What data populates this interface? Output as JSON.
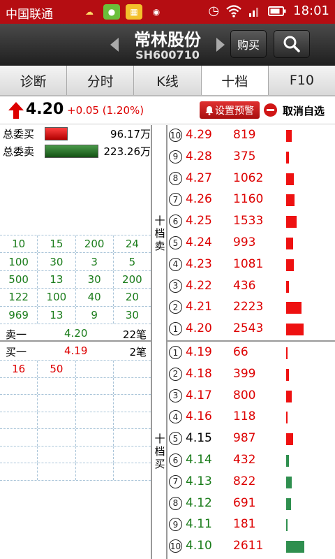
{
  "statusbar": {
    "carrier": "中国联通",
    "time": "18:01"
  },
  "header": {
    "stock_name": "常林股份",
    "stock_code": "SH600710",
    "buy_label": "购买"
  },
  "tabs": [
    {
      "label": "诊断",
      "active": false
    },
    {
      "label": "分时",
      "active": false
    },
    {
      "label": "K线",
      "active": false
    },
    {
      "label": "十档",
      "active": true
    },
    {
      "label": "F10",
      "active": false
    }
  ],
  "quote": {
    "price": "4.20",
    "change": "+0.05 (1.20%)",
    "alert_label": "设置预警",
    "remove_label": "取消自选"
  },
  "colors": {
    "up": "#dd0000",
    "down": "#1a7c1a",
    "neutral": "#000000",
    "statusbar": "#b50d12"
  },
  "weibi": {
    "buy_label": "总委买",
    "buy_value": "96.17万",
    "sell_label": "总委卖",
    "sell_value": "223.26万",
    "buy_ratio": 0.301,
    "sell_ratio": 0.699
  },
  "sell_detail": [
    [
      "10",
      "15",
      "200",
      "24"
    ],
    [
      "100",
      "30",
      "3",
      "5"
    ],
    [
      "500",
      "13",
      "30",
      "200"
    ],
    [
      "122",
      "100",
      "40",
      "20"
    ],
    [
      "969",
      "13",
      "9",
      "30"
    ]
  ],
  "sell_one": {
    "label": "卖一",
    "price": "4.20",
    "count": "22笔"
  },
  "buy_one": {
    "label": "买一",
    "price": "4.19",
    "count": "2笔"
  },
  "buy_detail": [
    [
      "16",
      "50",
      "",
      ""
    ],
    [
      "",
      "",
      "",
      ""
    ],
    [
      "",
      "",
      "",
      ""
    ],
    [
      "",
      "",
      "",
      ""
    ],
    [
      "",
      "",
      "",
      ""
    ],
    [
      "",
      "",
      "",
      ""
    ],
    [
      "",
      "",
      "",
      ""
    ]
  ],
  "labels": {
    "sell_side": "十档卖",
    "buy_side": "十档买"
  },
  "sell_levels": [
    {
      "n": "10",
      "price": "4.29",
      "vol": "819",
      "color": "up"
    },
    {
      "n": "9",
      "price": "4.28",
      "vol": "375",
      "color": "up"
    },
    {
      "n": "8",
      "price": "4.27",
      "vol": "1062",
      "color": "up"
    },
    {
      "n": "7",
      "price": "4.26",
      "vol": "1160",
      "color": "up"
    },
    {
      "n": "6",
      "price": "4.25",
      "vol": "1533",
      "color": "up"
    },
    {
      "n": "5",
      "price": "4.24",
      "vol": "993",
      "color": "up"
    },
    {
      "n": "4",
      "price": "4.23",
      "vol": "1081",
      "color": "up"
    },
    {
      "n": "3",
      "price": "4.22",
      "vol": "436",
      "color": "up"
    },
    {
      "n": "2",
      "price": "4.21",
      "vol": "2223",
      "color": "up"
    },
    {
      "n": "1",
      "price": "4.20",
      "vol": "2543",
      "color": "up"
    }
  ],
  "buy_levels": [
    {
      "n": "1",
      "price": "4.19",
      "vol": "66",
      "color": "up"
    },
    {
      "n": "2",
      "price": "4.18",
      "vol": "399",
      "color": "up"
    },
    {
      "n": "3",
      "price": "4.17",
      "vol": "800",
      "color": "up"
    },
    {
      "n": "4",
      "price": "4.16",
      "vol": "118",
      "color": "up"
    },
    {
      "n": "5",
      "price": "4.15",
      "vol": "987",
      "color": "neutral"
    },
    {
      "n": "6",
      "price": "4.14",
      "vol": "432",
      "color": "down"
    },
    {
      "n": "7",
      "price": "4.13",
      "vol": "822",
      "color": "down"
    },
    {
      "n": "8",
      "price": "4.12",
      "vol": "691",
      "color": "down"
    },
    {
      "n": "9",
      "price": "4.11",
      "vol": "181",
      "color": "down"
    },
    {
      "n": "10",
      "price": "4.10",
      "vol": "2611",
      "color": "down"
    }
  ]
}
